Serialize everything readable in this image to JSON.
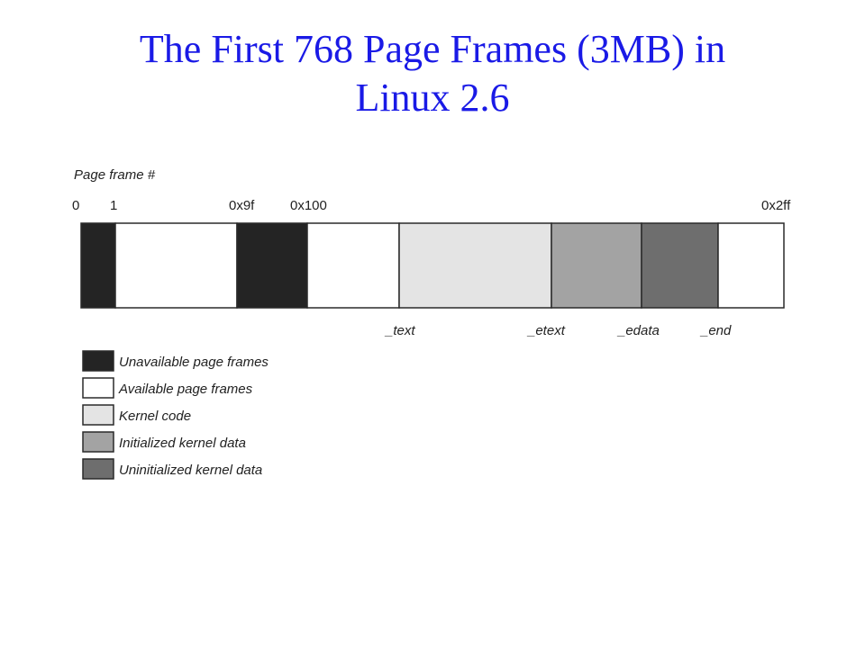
{
  "title": {
    "line1": "The First 768 Page Frames (3MB) in",
    "line2": "Linux 2.6"
  },
  "diagram": {
    "axis_label": "Page frame #",
    "top_ticks": [
      "0",
      "1",
      "0x9f",
      "0x100",
      "0x2ff"
    ],
    "bottom_ticks": [
      "_text",
      "_etext",
      "_edata",
      "_end"
    ],
    "segments": [
      {
        "kind": "unavailable",
        "color": "#242424"
      },
      {
        "kind": "available",
        "color": "#ffffff"
      },
      {
        "kind": "unavailable",
        "color": "#242424"
      },
      {
        "kind": "available",
        "color": "#ffffff"
      },
      {
        "kind": "kernel-code",
        "color": "#e4e4e4"
      },
      {
        "kind": "initialized-kernel-data",
        "color": "#a3a3a3"
      },
      {
        "kind": "uninitialized-kernel-data",
        "color": "#6e6e6e"
      },
      {
        "kind": "available",
        "color": "#ffffff"
      }
    ],
    "legend": [
      {
        "label": "Unavailable page frames",
        "color": "#242424"
      },
      {
        "label": "Available page frames",
        "color": "#ffffff"
      },
      {
        "label": "Kernel code",
        "color": "#e4e4e4"
      },
      {
        "label": "Initialized kernel data",
        "color": "#a3a3a3"
      },
      {
        "label": "Uninitialized kernel data",
        "color": "#6e6e6e"
      }
    ]
  }
}
